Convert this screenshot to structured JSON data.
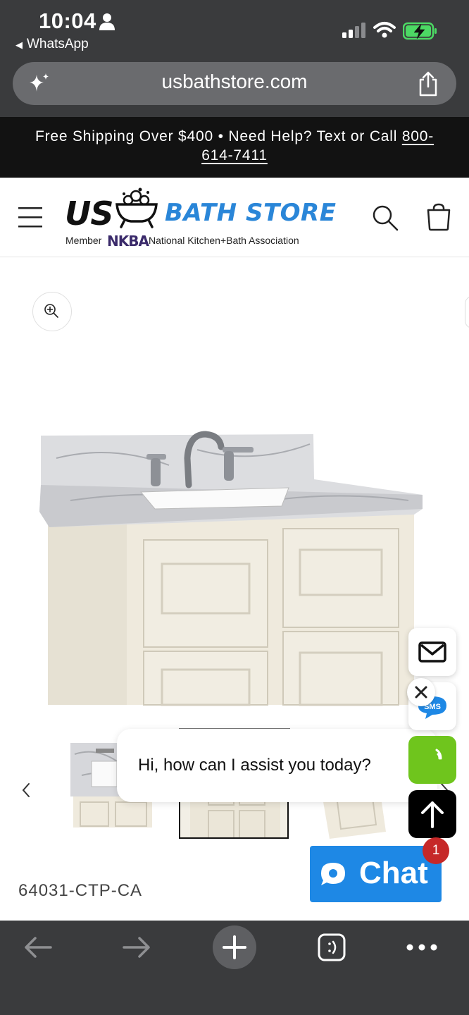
{
  "status_bar": {
    "time": "10:04",
    "back_app": "WhatsApp"
  },
  "browser": {
    "url": "usbathstore.com"
  },
  "banner": {
    "text_main": "Free Shipping Over $400 • Need Help? Text or Call ",
    "phone_part1": "800-",
    "phone_part2": "614-7411"
  },
  "logo": {
    "us": "US",
    "bath_store": "BATH STORE",
    "member": "Member",
    "nkba": "NKBA",
    "association": "National Kitchen+Bath Association"
  },
  "product": {
    "sku": "64031-CTP-CA"
  },
  "chat": {
    "greeting": "Hi, how can I assist you today?",
    "button_label": "Chat",
    "badge_count": "1",
    "sms_label": "SMS"
  },
  "colors": {
    "chrome": "#3a3b3d",
    "banner": "#121212",
    "brand_blue": "#2a86d8",
    "chat_blue": "#1e88e5",
    "call_green": "#6fc51d",
    "badge_red": "#c62828"
  }
}
